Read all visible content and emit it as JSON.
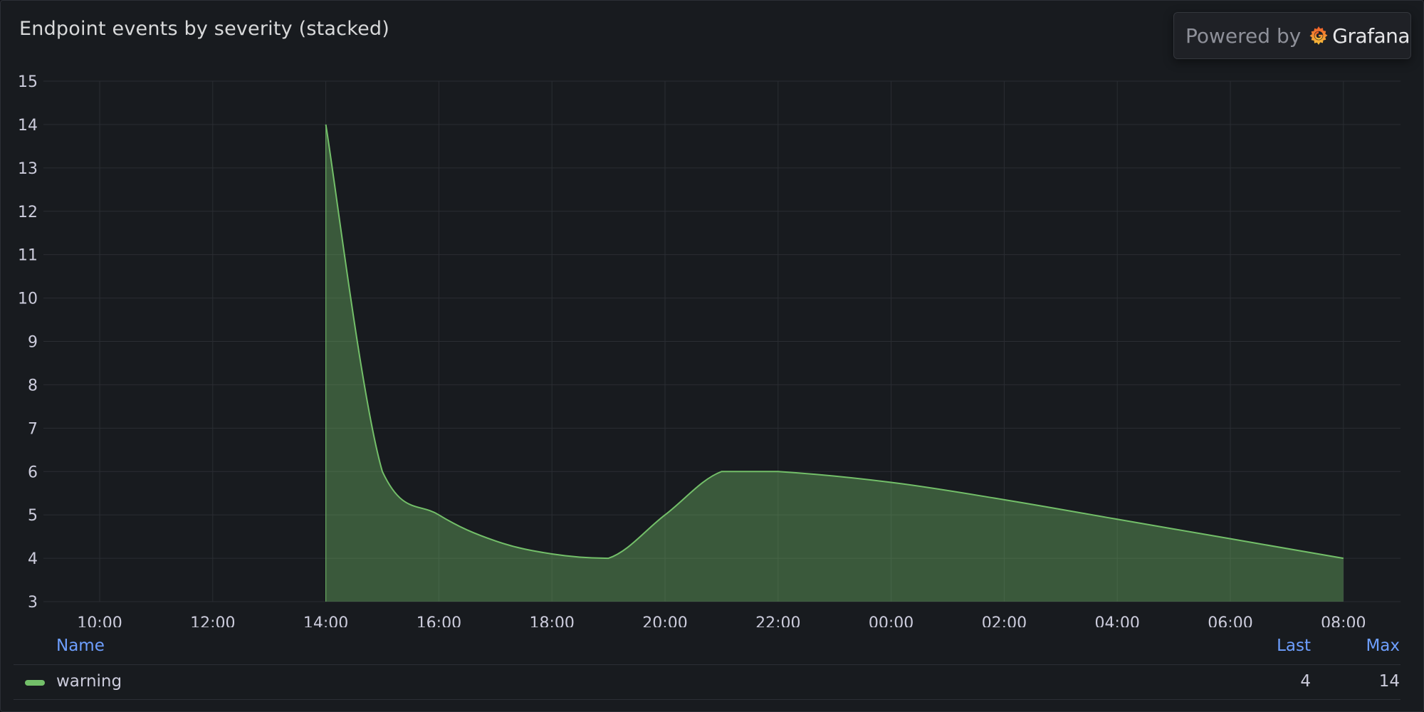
{
  "panel": {
    "title": "Endpoint events by severity (stacked)",
    "powered_by_label": "Powered by",
    "brand_name": "Grafana"
  },
  "colors": {
    "series_line": "#73bf69",
    "series_fill": "#73bf69",
    "legend_header": "#6e9fff"
  },
  "chart_data": {
    "type": "area",
    "title": "Endpoint events by severity (stacked)",
    "xlabel": "",
    "ylabel": "",
    "x_ticks": [
      "10:00",
      "12:00",
      "14:00",
      "16:00",
      "18:00",
      "20:00",
      "22:00",
      "00:00",
      "02:00",
      "04:00",
      "06:00",
      "08:00"
    ],
    "y_ticks": [
      3,
      4,
      5,
      6,
      7,
      8,
      9,
      10,
      11,
      12,
      13,
      14,
      15
    ],
    "xlim": [
      "09:00",
      "08:55 (+1 day)"
    ],
    "ylim": [
      3,
      15
    ],
    "grid": true,
    "stacked": true,
    "series": [
      {
        "name": "warning",
        "color": "#73bf69",
        "x": [
          "14:00",
          "15:00",
          "16:00",
          "17:00",
          "18:00",
          "19:00",
          "20:00",
          "21:00",
          "22:00",
          "00:00",
          "02:00",
          "04:00",
          "06:00",
          "08:00"
        ],
        "values": [
          14,
          6,
          5,
          4.4,
          4.1,
          4,
          5,
          6,
          6,
          5.75,
          5.35,
          4.9,
          4.45,
          4
        ]
      }
    ]
  },
  "legend": {
    "columns": {
      "name": "Name",
      "last": "Last",
      "max": "Max"
    },
    "rows": [
      {
        "name": "warning",
        "last": "4",
        "max": "14"
      }
    ]
  }
}
